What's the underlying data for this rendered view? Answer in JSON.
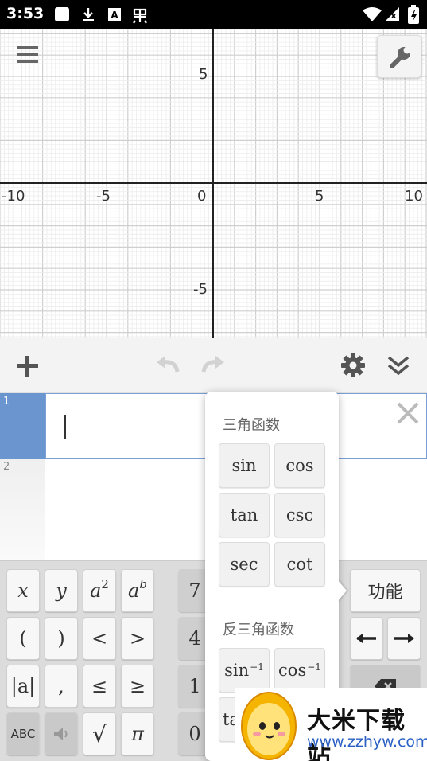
{
  "status_bar": {
    "time": "3:53",
    "icons": [
      "notification-square-icon",
      "download-icon",
      "a-badge-icon",
      "bug-icon",
      "wifi-icon",
      "signal-icon",
      "battery-icon"
    ]
  },
  "graph": {
    "x_ticks": [
      "-10",
      "-5",
      "0",
      "5",
      "10"
    ],
    "y_ticks": [
      "5",
      "-5"
    ],
    "x_range": [
      -10,
      10
    ],
    "y_range": [
      -7,
      7
    ],
    "grid": true
  },
  "expression_list": {
    "rows": [
      {
        "index": "1",
        "value": ""
      },
      {
        "index": "2",
        "value": ""
      }
    ]
  },
  "keypad": {
    "left_keys": [
      "x",
      "y",
      "a",
      "b",
      "(",
      ")",
      "<",
      ">",
      "|a|",
      ",",
      "≤",
      "≥",
      "ABC",
      "√",
      "π"
    ],
    "a_sup": "2",
    "b_sup": "b",
    "number_keys": [
      "7",
      "4",
      "1",
      "0"
    ],
    "function_label": "功能"
  },
  "func_popup": {
    "trig_title": "三角函数",
    "trig": [
      "sin",
      "cos",
      "tan",
      "csc",
      "sec",
      "cot"
    ],
    "inv_title": "反三角函数",
    "inv_base": [
      "sin",
      "cos",
      "ta"
    ],
    "inv_sup": "−1"
  },
  "watermark": {
    "title": "大米下载站",
    "url": "www.zzhyw.com"
  },
  "colors": {
    "accent": "#6a95cf",
    "axis": "#222222",
    "grid_major": "#cfcfcf",
    "grid_minor": "#ececec"
  }
}
